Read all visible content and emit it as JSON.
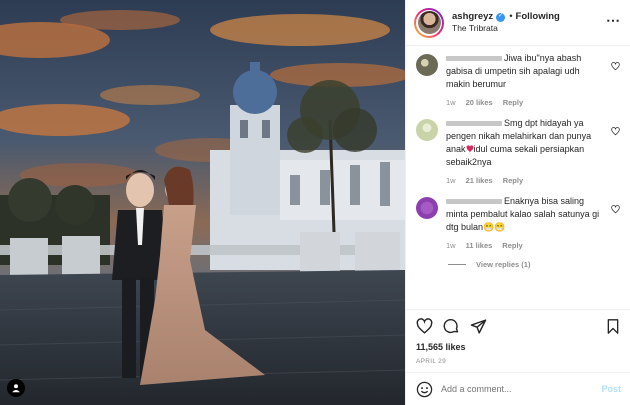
{
  "post": {
    "username": "ashgreyz",
    "follow_status": "Following",
    "location": "The Tribrata",
    "more_icon": "more-horizontal-icon",
    "likes": "11,565 likes",
    "date": "APRIL 29",
    "comment_placeholder": "Add a comment...",
    "post_label": "Post"
  },
  "comments": [
    {
      "text": "Jiwa ibu\"nya abash gabisa di umpetin sih apalagi udh makin berumur",
      "time": "1w",
      "likes": "20 likes",
      "reply": "Reply",
      "avatar_color": "#6b6a55"
    },
    {
      "text_before": "Smg dpt hidayah ya pengen nikah melahirkan dan punya anak",
      "text_after": "idul cuma sekali persiapkan sebaik2nya",
      "time": "1w",
      "likes": "21 likes",
      "reply": "Reply",
      "avatar_color": "#c8d4a8"
    },
    {
      "text": "Enaknya bisa saling minta pembalut kalao salah satunya gi dtg bulan😁😁",
      "time": "1w",
      "likes": "11 likes",
      "reply": "Reply",
      "avatar_color": "#8e3fae"
    }
  ],
  "view_replies": "View replies (1)",
  "colors": {
    "verified": "#3897f0",
    "post_disabled": "#b2dffc",
    "meta": "#8e8e8e"
  }
}
